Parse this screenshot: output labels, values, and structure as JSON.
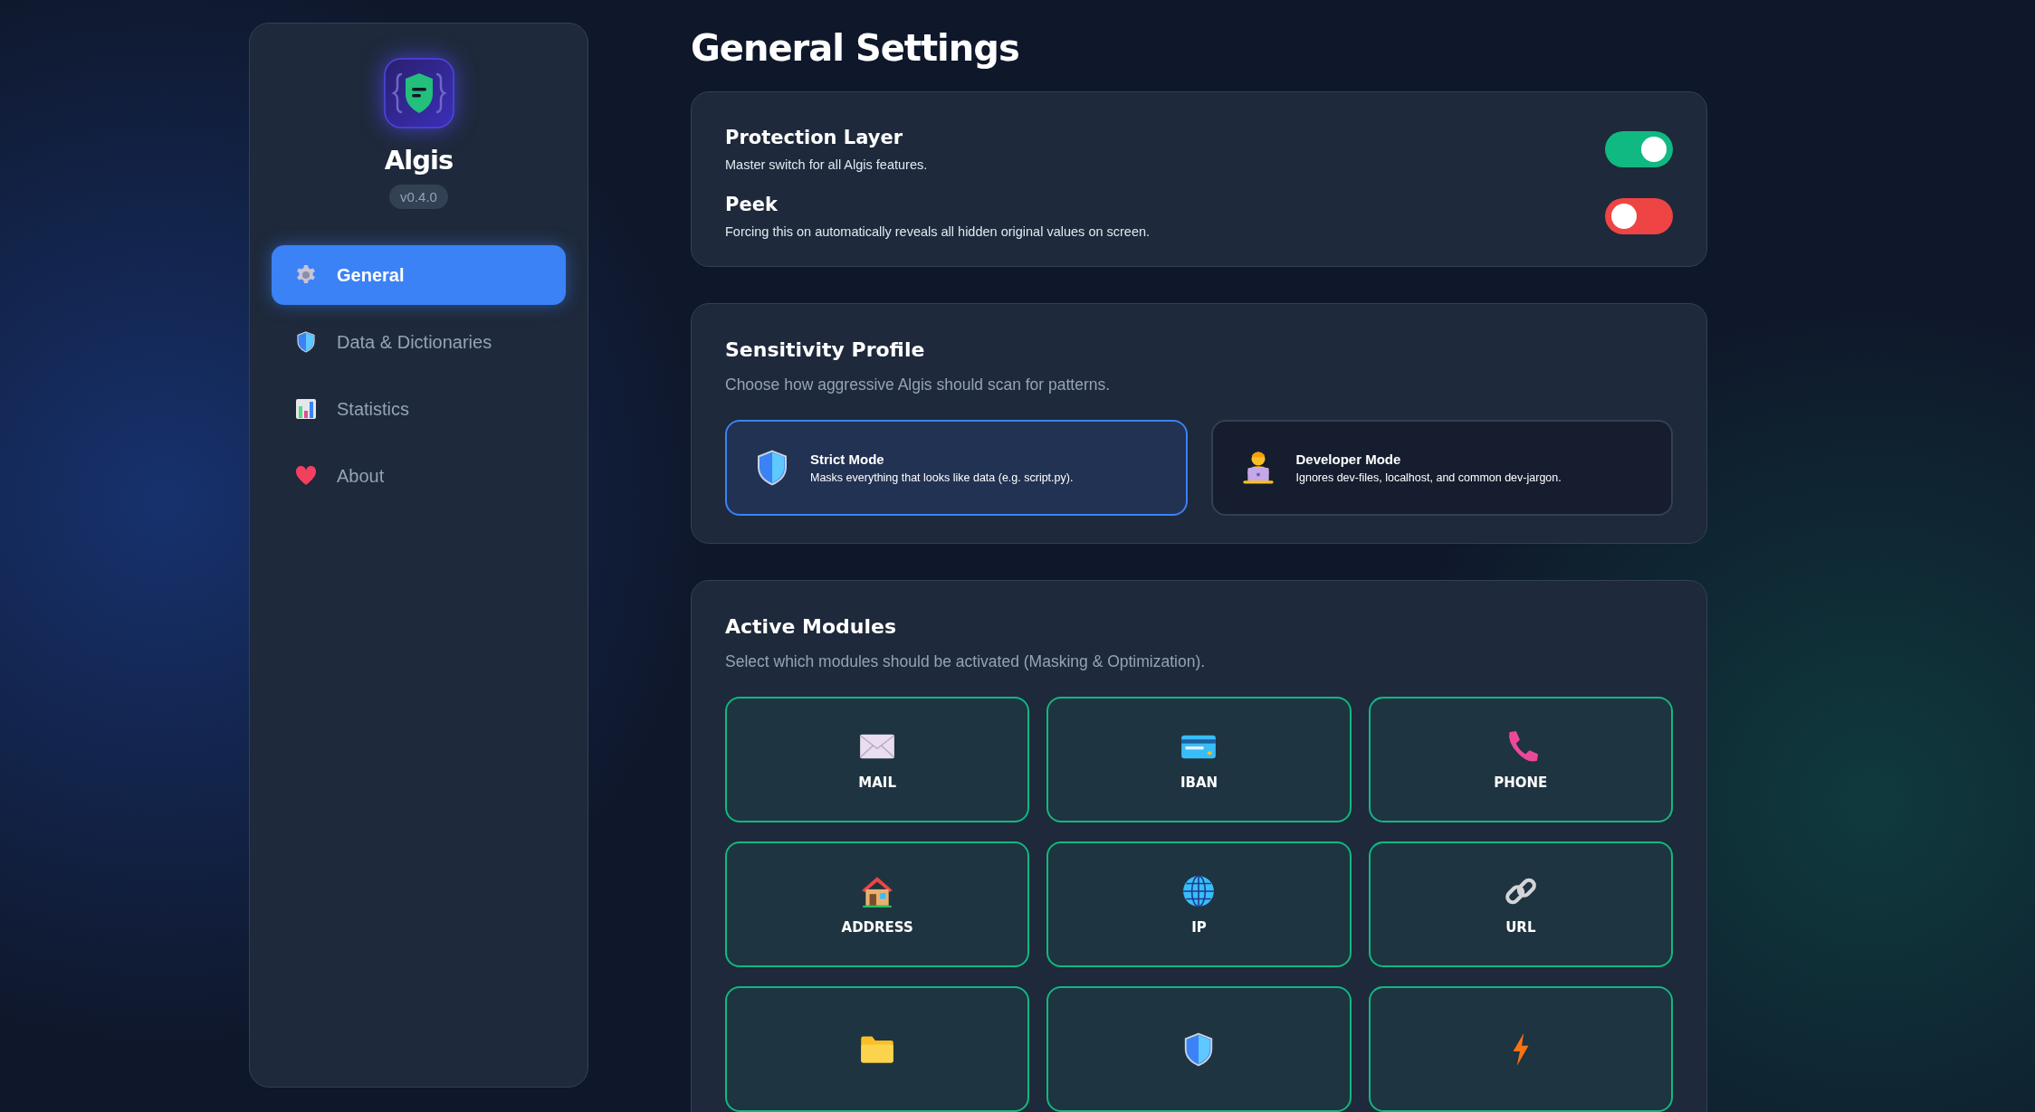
{
  "sidebar": {
    "app_name": "Algis",
    "version": "v0.4.0",
    "items": [
      {
        "label": "General",
        "selected": true
      },
      {
        "label": "Data & Dictionaries",
        "selected": false
      },
      {
        "label": "Statistics",
        "selected": false
      },
      {
        "label": "About",
        "selected": false
      }
    ]
  },
  "title": "General Settings",
  "general": {
    "toggles": [
      {
        "label": "Protection Layer",
        "description": "Master switch for all Algis features.",
        "on": true
      },
      {
        "label": "Peek",
        "description": "Forcing this on automatically reveals all hidden original values on screen.",
        "on": false
      }
    ]
  },
  "sensitivity": {
    "title": "Sensitivity Profile",
    "subtitle": "Choose how aggressive Algis should scan for patterns.",
    "options": [
      {
        "label": "Strict Mode",
        "description": "Masks everything that looks like data (e.g. script.py).",
        "selected": true
      },
      {
        "label": "Developer Mode",
        "description": "Ignores dev-files, localhost, and common dev-jargon.",
        "selected": false
      }
    ]
  },
  "modules": {
    "title": "Active Modules",
    "subtitle": "Select which modules should be activated (Masking & Optimization).",
    "items": [
      {
        "label": "MAIL",
        "active": true
      },
      {
        "label": "IBAN",
        "active": true
      },
      {
        "label": "PHONE",
        "active": true
      },
      {
        "label": "ADDRESS",
        "active": true
      },
      {
        "label": "IP",
        "active": true
      },
      {
        "label": "URL",
        "active": true
      },
      {
        "active": true
      },
      {
        "active": true
      },
      {
        "active": true
      }
    ]
  }
}
